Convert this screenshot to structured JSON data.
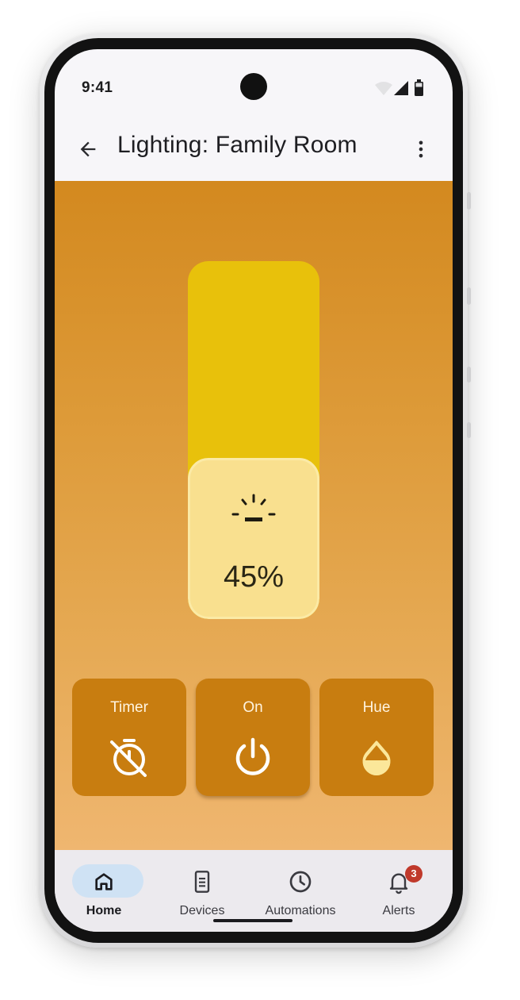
{
  "status_bar": {
    "time": "9:41",
    "icons": [
      "wifi-icon",
      "signal-icon",
      "battery-icon"
    ]
  },
  "app_bar": {
    "title": "Lighting: Family Room",
    "back_icon": "arrow-back-icon",
    "more_icon": "more-vert-icon"
  },
  "brightness": {
    "value_label": "45%",
    "level_percent": 45,
    "icon": "brightness-low-icon"
  },
  "controls": [
    {
      "label": "Timer",
      "icon": "timer-off-icon"
    },
    {
      "label": "On",
      "icon": "power-icon"
    },
    {
      "label": "Hue",
      "icon": "hue-drop-icon"
    }
  ],
  "nav": {
    "items": [
      {
        "label": "Home",
        "icon": "home-icon",
        "active": true
      },
      {
        "label": "Devices",
        "icon": "device-icon",
        "active": false
      },
      {
        "label": "Automations",
        "icon": "clock-icon",
        "active": false
      },
      {
        "label": "Alerts",
        "icon": "bell-icon",
        "active": false,
        "badge": "3"
      }
    ]
  },
  "colors": {
    "background_top": "#d3891f",
    "background_bottom": "#efb670",
    "slider_track": "#e8c10b",
    "slider_fill": "#f9e08f",
    "control_tile": "#c87d10",
    "nav_active_pill": "#cfe2f4",
    "badge": "#c0392b"
  }
}
